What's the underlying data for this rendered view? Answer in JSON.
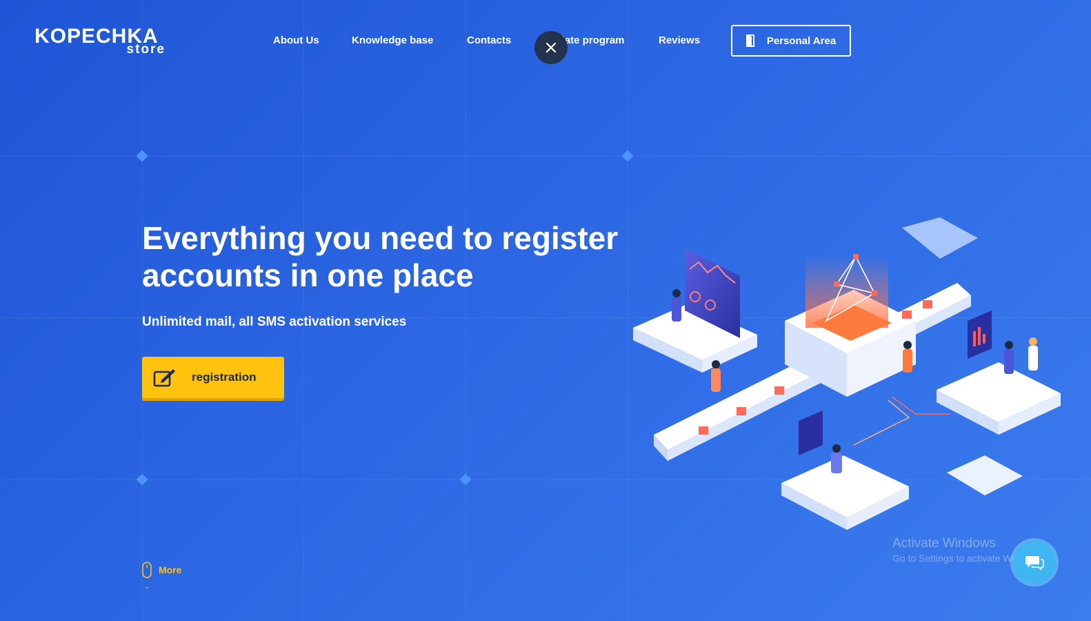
{
  "logo": {
    "top": "KOPECHKA",
    "bottom": "store"
  },
  "nav": {
    "about": "About Us",
    "knowledge": "Knowledge base",
    "contacts": "Contacts",
    "affiliate": "affiliate program",
    "reviews": "Reviews"
  },
  "personal_area": {
    "label": "Personal Area",
    "icon": "door-icon"
  },
  "close_icon": "close-icon",
  "hero": {
    "title": "Everything you need to register accounts in one place",
    "subtitle": "Unlimited mail, all SMS activation services",
    "register_label": "registration",
    "register_icon": "edit-icon"
  },
  "more": {
    "label": "More",
    "icon": "mouse-icon"
  },
  "watermark": {
    "title": "Activate Windows",
    "subtitle": "Go to Settings to activate Windows."
  },
  "chat_icon": "chat-icon",
  "colors": {
    "background_start": "#1f55d6",
    "background_end": "#3b7cee",
    "accent_yellow": "#ffc20e",
    "close_dark": "#24334d",
    "chat_blue": "#3fb6f2"
  }
}
